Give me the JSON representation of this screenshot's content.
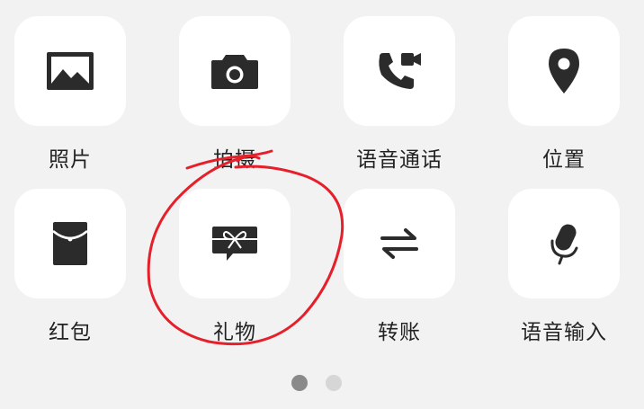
{
  "grid": {
    "items": [
      {
        "label": "照片",
        "icon": "photo-icon"
      },
      {
        "label": "拍摄",
        "icon": "camera-icon"
      },
      {
        "label": "语音通话",
        "icon": "voice-call-icon"
      },
      {
        "label": "位置",
        "icon": "location-icon"
      },
      {
        "label": "红包",
        "icon": "red-packet-icon"
      },
      {
        "label": "礼物",
        "icon": "gift-icon"
      },
      {
        "label": "转账",
        "icon": "transfer-icon"
      },
      {
        "label": "语音输入",
        "icon": "microphone-icon"
      }
    ]
  },
  "pager": {
    "total_pages": 2,
    "current_page": 1
  },
  "colors": {
    "background": "#f2f2f2",
    "tile": "#ffffff",
    "icon": "#2b2b2b",
    "label": "#222222",
    "dot_active": "#8a8a8a",
    "dot_inactive": "#d6d6d6",
    "annotation": "#e5202a"
  }
}
